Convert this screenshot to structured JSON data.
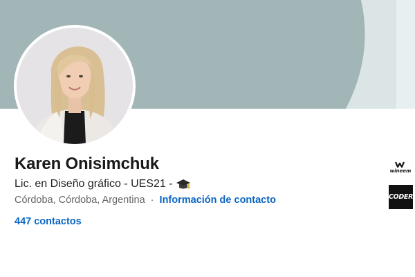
{
  "profile": {
    "name": "Karen Onisimchuk",
    "headline": "Lic. en Diseño gráfico - UES21 -",
    "headline_icon": "graduation-cap-icon",
    "location": "Córdoba, Córdoba, Argentina",
    "separator": "·",
    "contact_info_label": "Información de contacto",
    "connections_label": "447 contactos"
  },
  "experience_logos": {
    "company_1": "wineem",
    "company_2": "CODER"
  },
  "colors": {
    "banner": "#a2b6b8",
    "link": "#0a66c2",
    "text_primary": "#191919",
    "text_secondary": "#666666"
  }
}
